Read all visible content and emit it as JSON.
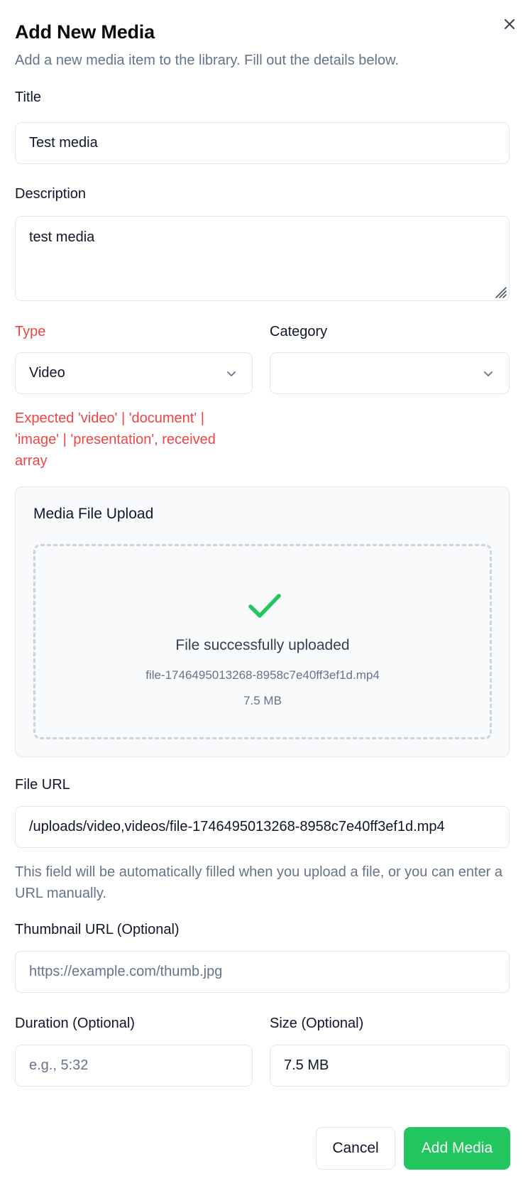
{
  "dialog": {
    "title": "Add New Media",
    "subtitle": "Add a new media item to the library. Fill out the details below.",
    "close_icon": "close-icon"
  },
  "fields": {
    "title": {
      "label": "Title",
      "value": "Test media"
    },
    "description": {
      "label": "Description",
      "value": "test media"
    },
    "type": {
      "label": "Type",
      "value": "Video",
      "error": "Expected 'video' | 'document' | 'image' | 'presentation', received array"
    },
    "category": {
      "label": "Category",
      "value": ""
    },
    "file_url": {
      "label": "File URL",
      "value": "/uploads/video,videos/file-1746495013268-8958c7e40ff3ef1d.mp4",
      "helper": "This field will be automatically filled when you upload a file, or you can enter a URL manually."
    },
    "thumbnail_url": {
      "label": "Thumbnail URL (Optional)",
      "value": "",
      "placeholder": "https://example.com/thumb.jpg"
    },
    "duration": {
      "label": "Duration (Optional)",
      "value": "",
      "placeholder": "e.g., 5:32"
    },
    "size": {
      "label": "Size (Optional)",
      "value": "7.5 MB"
    }
  },
  "upload": {
    "title": "Media File Upload",
    "status": "File successfully uploaded",
    "filename": "file-1746495013268-8958c7e40ff3ef1d.mp4",
    "size": "7.5 MB",
    "icon": "checkmark-icon"
  },
  "actions": {
    "cancel_label": "Cancel",
    "submit_label": "Add Media"
  },
  "colors": {
    "primary": "#22c55e",
    "error": "#ef4444",
    "muted": "#64748b"
  }
}
